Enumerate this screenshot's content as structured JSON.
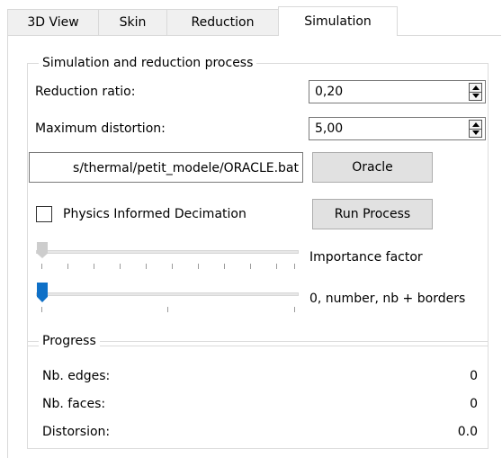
{
  "tabs": [
    {
      "label": "3D View"
    },
    {
      "label": "Skin"
    },
    {
      "label": "Reduction"
    },
    {
      "label": "Simulation",
      "active": true
    }
  ],
  "simulation_group": {
    "title": "Simulation and reduction process",
    "reduction_ratio": {
      "label": "Reduction ratio:",
      "value": "0,20"
    },
    "maximum_distortion": {
      "label": "Maximum distortion:",
      "value": "5,00"
    },
    "oracle_path": {
      "value": "s/thermal/petit_modele/ORACLE.bat"
    },
    "oracle_button": {
      "label": "Oracle"
    },
    "physics_checkbox": {
      "label": "Physics Informed Decimation",
      "checked": false
    },
    "run_button": {
      "label": "Run Process"
    },
    "importance_slider": {
      "label": "Importance factor",
      "value": 0,
      "enabled": false
    },
    "borders_slider": {
      "label": "0, number, nb + borders",
      "value": 0
    }
  },
  "progress_group": {
    "title": "Progress",
    "rows": [
      {
        "label": "Nb. edges:",
        "value": "0"
      },
      {
        "label": "Nb. faces:",
        "value": "0"
      },
      {
        "label": "Distorsion:",
        "value": "0.0"
      }
    ]
  },
  "colors": {
    "accent": "#0f70c7",
    "tab_inactive": "#f0f0f0",
    "button": "#e1e1e1"
  }
}
